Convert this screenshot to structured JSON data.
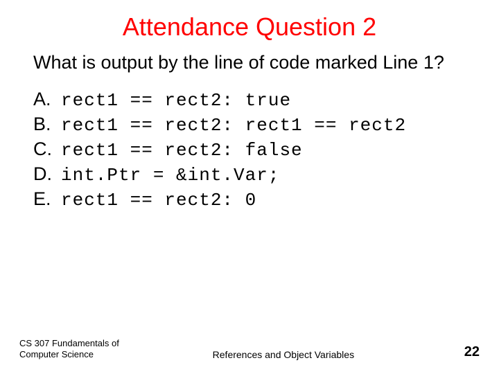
{
  "title": "Attendance Question 2",
  "question": "What is output by the line of code marked Line 1?",
  "options": [
    {
      "label": "A.",
      "code": "rect1 == rect2: true"
    },
    {
      "label": "B.",
      "code": "rect1 == rect2: rect1 == rect2"
    },
    {
      "label": "C.",
      "code": "rect1 == rect2: false"
    },
    {
      "label": "D.",
      "code": "int.Ptr = &int.Var;"
    },
    {
      "label": "E.",
      "code": "rect1 == rect2: 0"
    }
  ],
  "footer": {
    "left_line1": "CS 307 Fundamentals of",
    "left_line2": "Computer Science",
    "center": "References and Object Variables",
    "page": "22"
  }
}
